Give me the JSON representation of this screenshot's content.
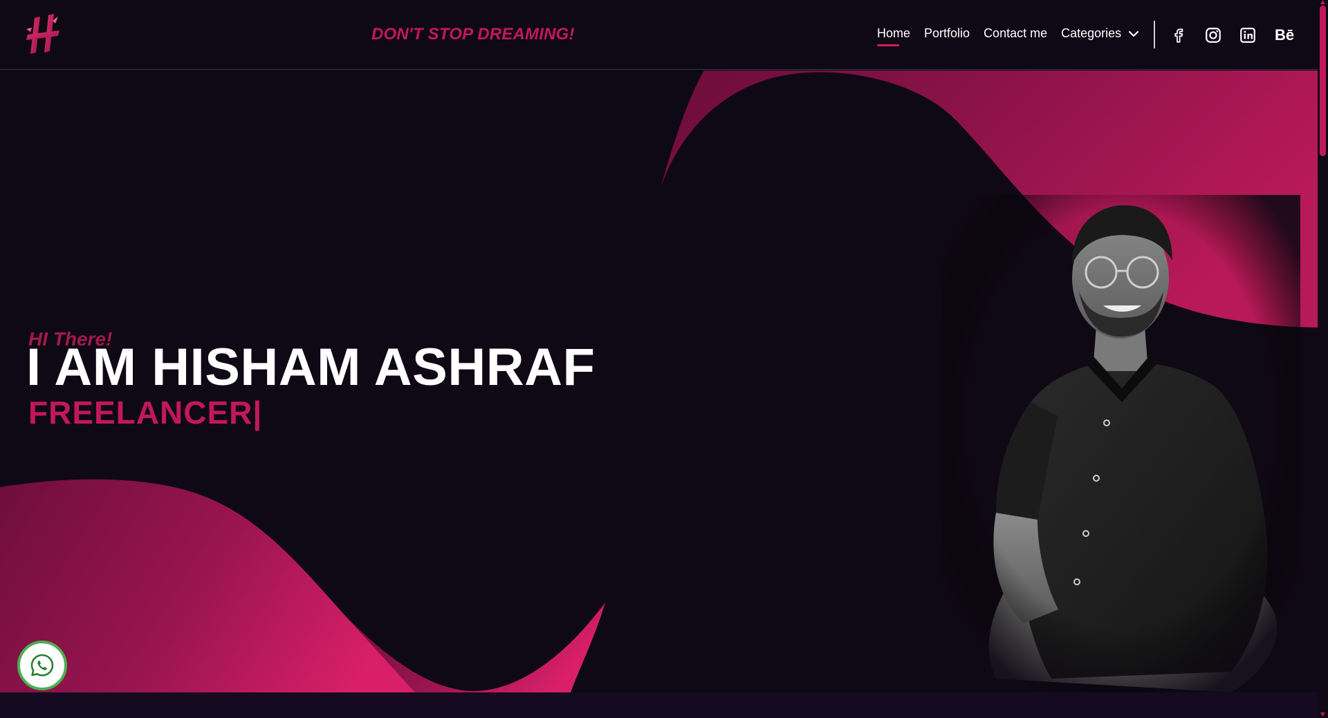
{
  "header": {
    "tagline": "DON'T STOP DREAMING!",
    "nav": [
      {
        "label": "Home",
        "active": true
      },
      {
        "label": "Portfolio",
        "active": false
      },
      {
        "label": "Contact me",
        "active": false
      },
      {
        "label": "Categories",
        "active": false,
        "dropdown": true
      }
    ],
    "social": [
      "facebook-icon",
      "instagram-icon",
      "linkedin-icon",
      "behance-icon"
    ],
    "behance_text": "Bē"
  },
  "hero": {
    "greeting": "HI There!",
    "name": "I AM HISHAM ASHRAF",
    "role": "FREELANCER|"
  },
  "colors": {
    "background": "#0f0815",
    "accent": "#c2185b",
    "accent_dark": "#6b0d3a",
    "whatsapp": "#4caf50"
  }
}
